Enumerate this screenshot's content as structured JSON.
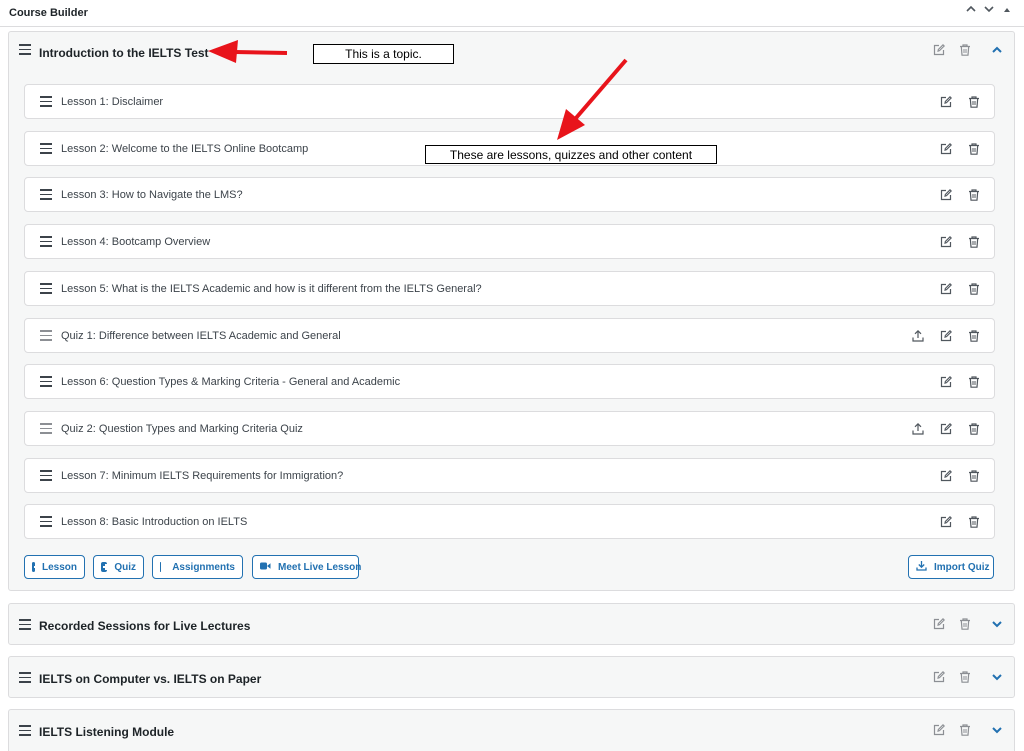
{
  "panel": {
    "title": "Course Builder",
    "controls": [
      "^",
      "v",
      "▲"
    ]
  },
  "topics": [
    {
      "title": "Introduction to the IELTS Test",
      "expanded": true
    },
    {
      "title": "Recorded Sessions for Live Lectures",
      "expanded": false
    },
    {
      "title": "IELTS on Computer vs. IELTS on Paper",
      "expanded": false
    },
    {
      "title": "IELTS Listening Module",
      "expanded": false
    }
  ],
  "items": [
    {
      "title": "Lesson 1: Disclaimer",
      "kind": "lesson"
    },
    {
      "title": "Lesson 2: Welcome to the IELTS Online Bootcamp",
      "kind": "lesson"
    },
    {
      "title": "Lesson 3: How to Navigate the LMS?",
      "kind": "lesson"
    },
    {
      "title": "Lesson 4: Bootcamp Overview",
      "kind": "lesson"
    },
    {
      "title": "Lesson 5: What is the IELTS Academic and how is it different from the IELTS General?",
      "kind": "lesson"
    },
    {
      "title": "Quiz 1: Difference between IELTS Academic and General",
      "kind": "quiz"
    },
    {
      "title": "Lesson 6: Question Types & Marking Criteria - General and Academic",
      "kind": "lesson"
    },
    {
      "title": "Quiz 2: Question Types and Marking Criteria Quiz",
      "kind": "quiz"
    },
    {
      "title": "Lesson 7: Minimum IELTS Requirements for Immigration?",
      "kind": "lesson"
    },
    {
      "title": "Lesson 8: Basic Introduction on IELTS",
      "kind": "lesson"
    }
  ],
  "buttons": {
    "lesson": "Lesson",
    "quiz": "Quiz",
    "assignments": "Assignments",
    "meet_live": "Meet Live Lesson",
    "import_quiz": "Import Quiz"
  },
  "annotations": {
    "topic_note": "This is a topic.",
    "content_note": "These are lessons, quizzes and other content"
  },
  "colors": {
    "accent": "#2271b1",
    "arrow": "#e8141b",
    "border": "#dcdcde"
  }
}
